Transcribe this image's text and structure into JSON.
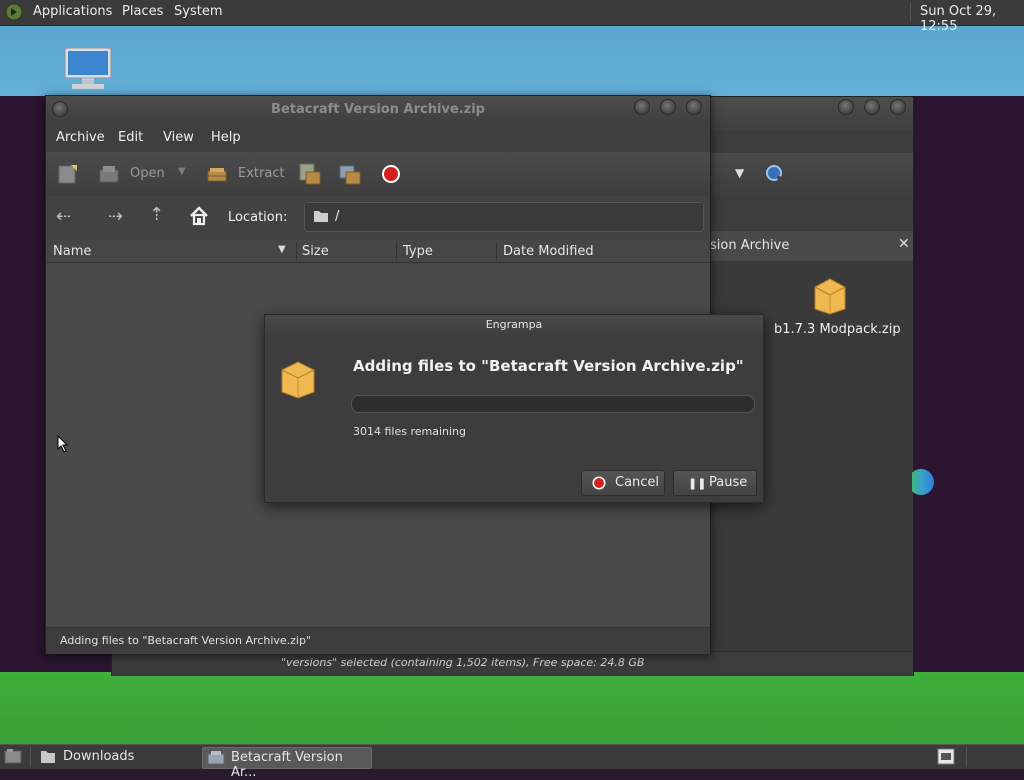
{
  "top_panel": {
    "menus": [
      "Applications",
      "Places",
      "System"
    ],
    "clock": "Sun Oct 29, 12:55"
  },
  "file_manager": {
    "tab_label": "sion Archive",
    "file_name": "b1.7.3 Modpack.zip",
    "status": "\"versions\" selected (containing 1,502 items), Free space: 24.8 GB"
  },
  "engrampa": {
    "title": "Betacraft Version Archive.zip",
    "menu": [
      "Archive",
      "Edit",
      "View",
      "Help"
    ],
    "toolbar": {
      "open_label": "Open",
      "extract_label": "Extract"
    },
    "location_label": "Location:",
    "location_value": "/",
    "columns": [
      "Name",
      "Size",
      "Type",
      "Date Modified"
    ],
    "status": "Adding files to \"Betacraft Version Archive.zip\""
  },
  "dialog": {
    "title": "Engrampa",
    "heading": "Adding files to \"Betacraft Version Archive.zip\"",
    "remaining": "3014 files remaining",
    "progress": 0.0,
    "cancel_label": "Cancel",
    "pause_label": "Pause"
  },
  "taskbar": {
    "items": [
      "Downloads",
      "Betacraft Version Ar..."
    ]
  },
  "colors": {
    "accent_red": "#d31f1f",
    "panel": "#3b3b3b",
    "sky": "#5aa6cf",
    "grass": "#3fae3a"
  }
}
